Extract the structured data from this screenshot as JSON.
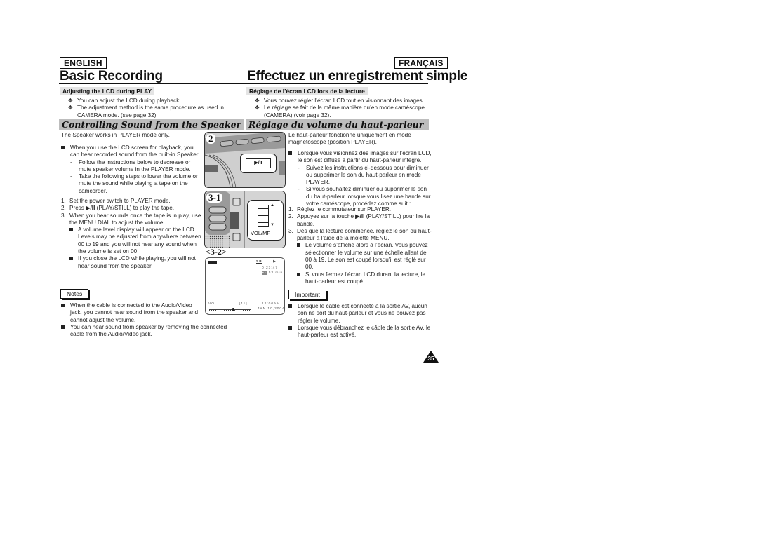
{
  "page": {
    "number": "35"
  },
  "english": {
    "lang_label": "ENGLISH",
    "title": "Basic Recording",
    "sub_heading": "Adjusting the LCD during PLAY",
    "lcd_bullets": [
      "You can adjust the LCD during playback.",
      "The adjustment method is the same procedure as used in CAMERA mode. (see page 32)"
    ],
    "section_title": "Controlling Sound from the Speaker",
    "intro": "The Speaker works in PLAYER mode only.",
    "bullet_main": "When you use the LCD screen for playback, you can hear recorded sound from the built-in Speaker.",
    "dash_items": [
      "Follow the instructions below to decrease or mute speaker volume in the PLAYER mode.",
      "Take the following steps to lower the volume or mute the sound while playing a tape on the camcorder."
    ],
    "steps": [
      {
        "num": "1.",
        "text": "Set the power switch to PLAYER mode."
      },
      {
        "num": "2.",
        "pre": "Press ",
        "icon": "▶/II",
        "text": " (PLAY/STILL) to play the tape."
      },
      {
        "num": "3.",
        "text": "When you hear sounds once the tape is in play, use the MENU DIAL to adjust the volume."
      }
    ],
    "step3_bullets": [
      "A volume level display will appear on the LCD. Levels may be adjusted from anywhere between 00 to 19 and you will not hear any sound when the volume is set on 00.",
      "If you close the LCD while playing, you will not hear sound from the speaker."
    ],
    "notes_label": "Notes",
    "notes": [
      "When the cable is connected to the Audio/Video jack, you cannot hear sound from the speaker and cannot adjust the volume.",
      "You can hear sound from speaker by removing the connected cable from the Audio/Video jack."
    ]
  },
  "french": {
    "lang_label": "FRANÇAIS",
    "title": "Effectuez un enregistrement simple",
    "sub_heading": "Réglage de l’écran LCD lors de la lecture",
    "lcd_bullets": [
      "Vous pouvez régler l’écran LCD tout en visionnant des images.",
      "Le réglage se fait de la même manière qu’en mode caméscope (CAMERA) (voir page 32)."
    ],
    "section_title": "Réglage du volume du haut-parleur",
    "intro": "Le haut-parleur fonctionne uniquement en mode magnétoscope (position PLAYER).",
    "bullet_main": "Lorsque vous visionnez des images sur l’écran LCD, le son est diffusé à partir du haut-parleur intégré.",
    "dash_items": [
      "Suivez les instructions ci-dessous pour diminuer ou supprimer le son du haut-parleur en mode PLAYER.",
      "Si vous souhaitez diminuer ou supprimer le son du haut-parleur lorsque vous lisez une bande sur votre caméscope, procédez comme suit :"
    ],
    "steps": [
      {
        "num": "1.",
        "text": "Réglez le commutateur sur PLAYER."
      },
      {
        "num": "2.",
        "pre": "Appuyez sur la touche ",
        "icon": "▶/II",
        "text": " (PLAY/STILL) pour lire la bande."
      },
      {
        "num": "3.",
        "text": "Dès que la lecture commence, réglez le son du haut-parleur à l’aide de la molette MENU."
      }
    ],
    "step3_bullets": [
      "Le volume s’affiche alors à l’écran. Vous pouvez sélectionner le volume sur une échelle allant de 00 à 19. Le son est coupé lorsqu’il est réglé sur 00.",
      "Si vous fermez l’écran LCD durant la lecture, le haut-parleur est coupé."
    ],
    "notes_label": "Important",
    "notes": [
      "Lorsque le câble est connecté à la sortie AV, aucun son ne sort du haut-parleur et vous ne pouvez pas régler le volume.",
      "Lorsque vous débranchez le câble de la sortie AV, le haut-parleur est activé."
    ]
  },
  "figures": {
    "fig2_label": "2",
    "fig2_button": "▶/II",
    "fig31_label": "3-1",
    "fig31_dial_label": "VOL/MF",
    "fig31_up": "▲",
    "fig31_down": "▼",
    "fig32_label": "<3-2>",
    "osd": {
      "mode": "SP",
      "play_icon": "▶",
      "counter": "0:23:47",
      "remain_badge": "▪▪",
      "remain": "53 min",
      "vol_label": "VOL.",
      "vol_value": "[11]",
      "vol_level": 11,
      "vol_max": 19,
      "time": "12:00AM",
      "date": "JAN.10,2004"
    }
  }
}
